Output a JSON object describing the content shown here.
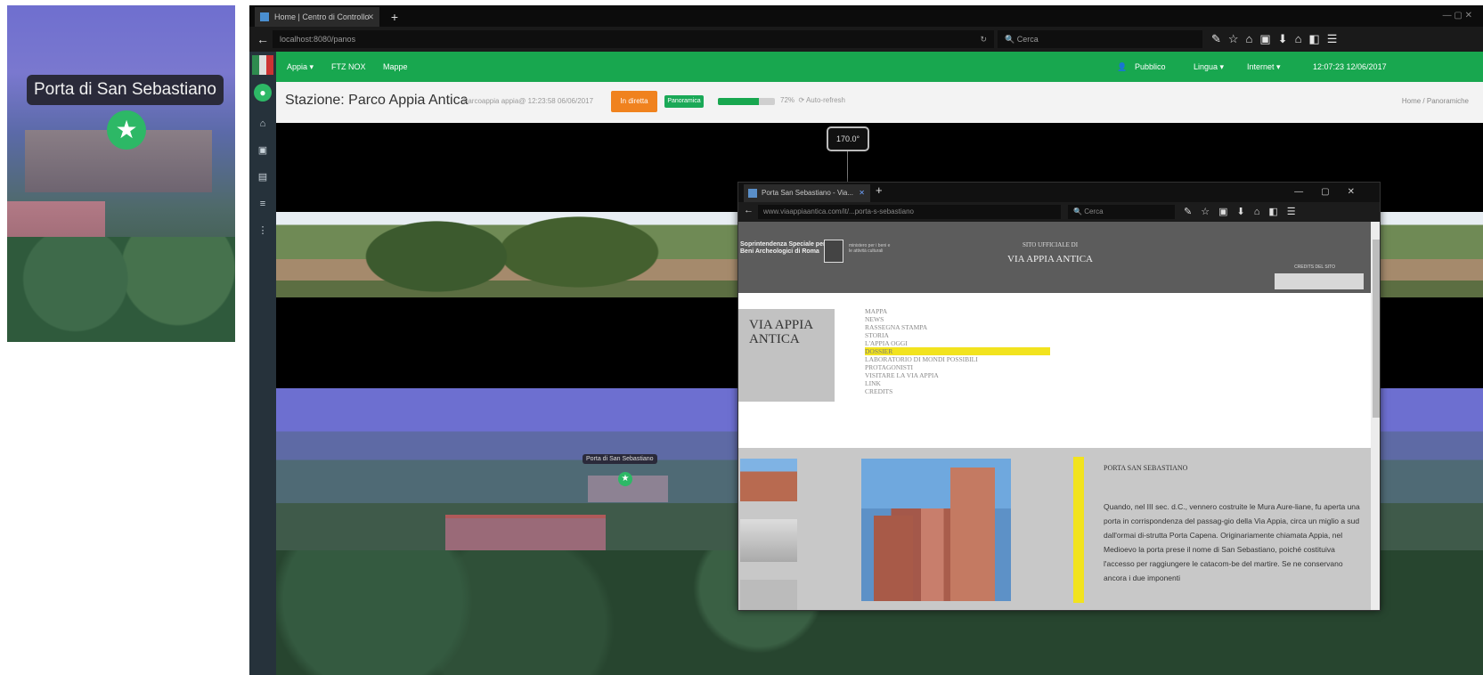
{
  "inset": {
    "label": "Porta di San Sebastiano"
  },
  "browser": {
    "tab_title": "Home | Centro di Controllo",
    "url": "localhost:8080/panos",
    "search_placeholder": "Cerca"
  },
  "app": {
    "nav": [
      "Appia ▾",
      "FTZ NOX",
      "Mappe"
    ],
    "user": "Pubblico",
    "lang": "Lingua ▾",
    "internet": "Internet ▾",
    "clock": "12:07:23 12/06/2017",
    "station_title": "Stazione: Parco Appia Antica",
    "station_meta": "Parcoappia appia@ 12:23:58 06/06/2017",
    "orange_btn": "In diretta",
    "green_badge": "Panoramica",
    "progress": 0.72,
    "progress_text": "72%",
    "auto_refresh": "Auto-refresh",
    "breadcrumbs": "Home  /  Panoramiche"
  },
  "pano": {
    "angle": "170.0°",
    "label": "Porta di San Sebastiano"
  },
  "popup": {
    "tab_title": "Porta San Sebastiano - Via...",
    "url": "www.viaappiaantica.com/it/...porta-s-sebastiano",
    "search_placeholder": "Cerca",
    "logo_text": "Soprintendenza Speciale per i Beni Archeologici di Roma",
    "logo_small": "ministero per i beni e le attività culturali",
    "site_line1": "SITO UFFICIALE DI",
    "site_line2": "VIA APPIA ANTICA",
    "credit": "CREDITS DEL SITO",
    "title_box": "VIA APPIA ANTICA",
    "menu": [
      "MAPPA",
      "NEWS",
      "RASSEGNA STAMPA",
      "STORIA",
      "L'APPIA OGGI",
      "DOSSIER",
      "LABORATORIO DI MONDI POSSIBILI",
      "PROTAGONISTI",
      "VISITARE LA VIA APPIA",
      "LINK",
      "CREDITS"
    ],
    "menu_highlight_index": 5,
    "content_title": "PORTA SAN SEBASTIANO",
    "content_body": "Quando, nel III sec. d.C., vennero costruite le Mura Aure-liane, fu aperta una porta in corrispondenza del passag-gio della Via Appia, circa un miglio a sud dall'ormai di-strutta Porta Capena. Originariamente chiamata Appia, nel Medioevo la porta prese il nome di San Sebastiano, poiché costituiva l'accesso per raggiungere le catacom-be del martire. Se ne conservano ancora i due imponenti"
  }
}
